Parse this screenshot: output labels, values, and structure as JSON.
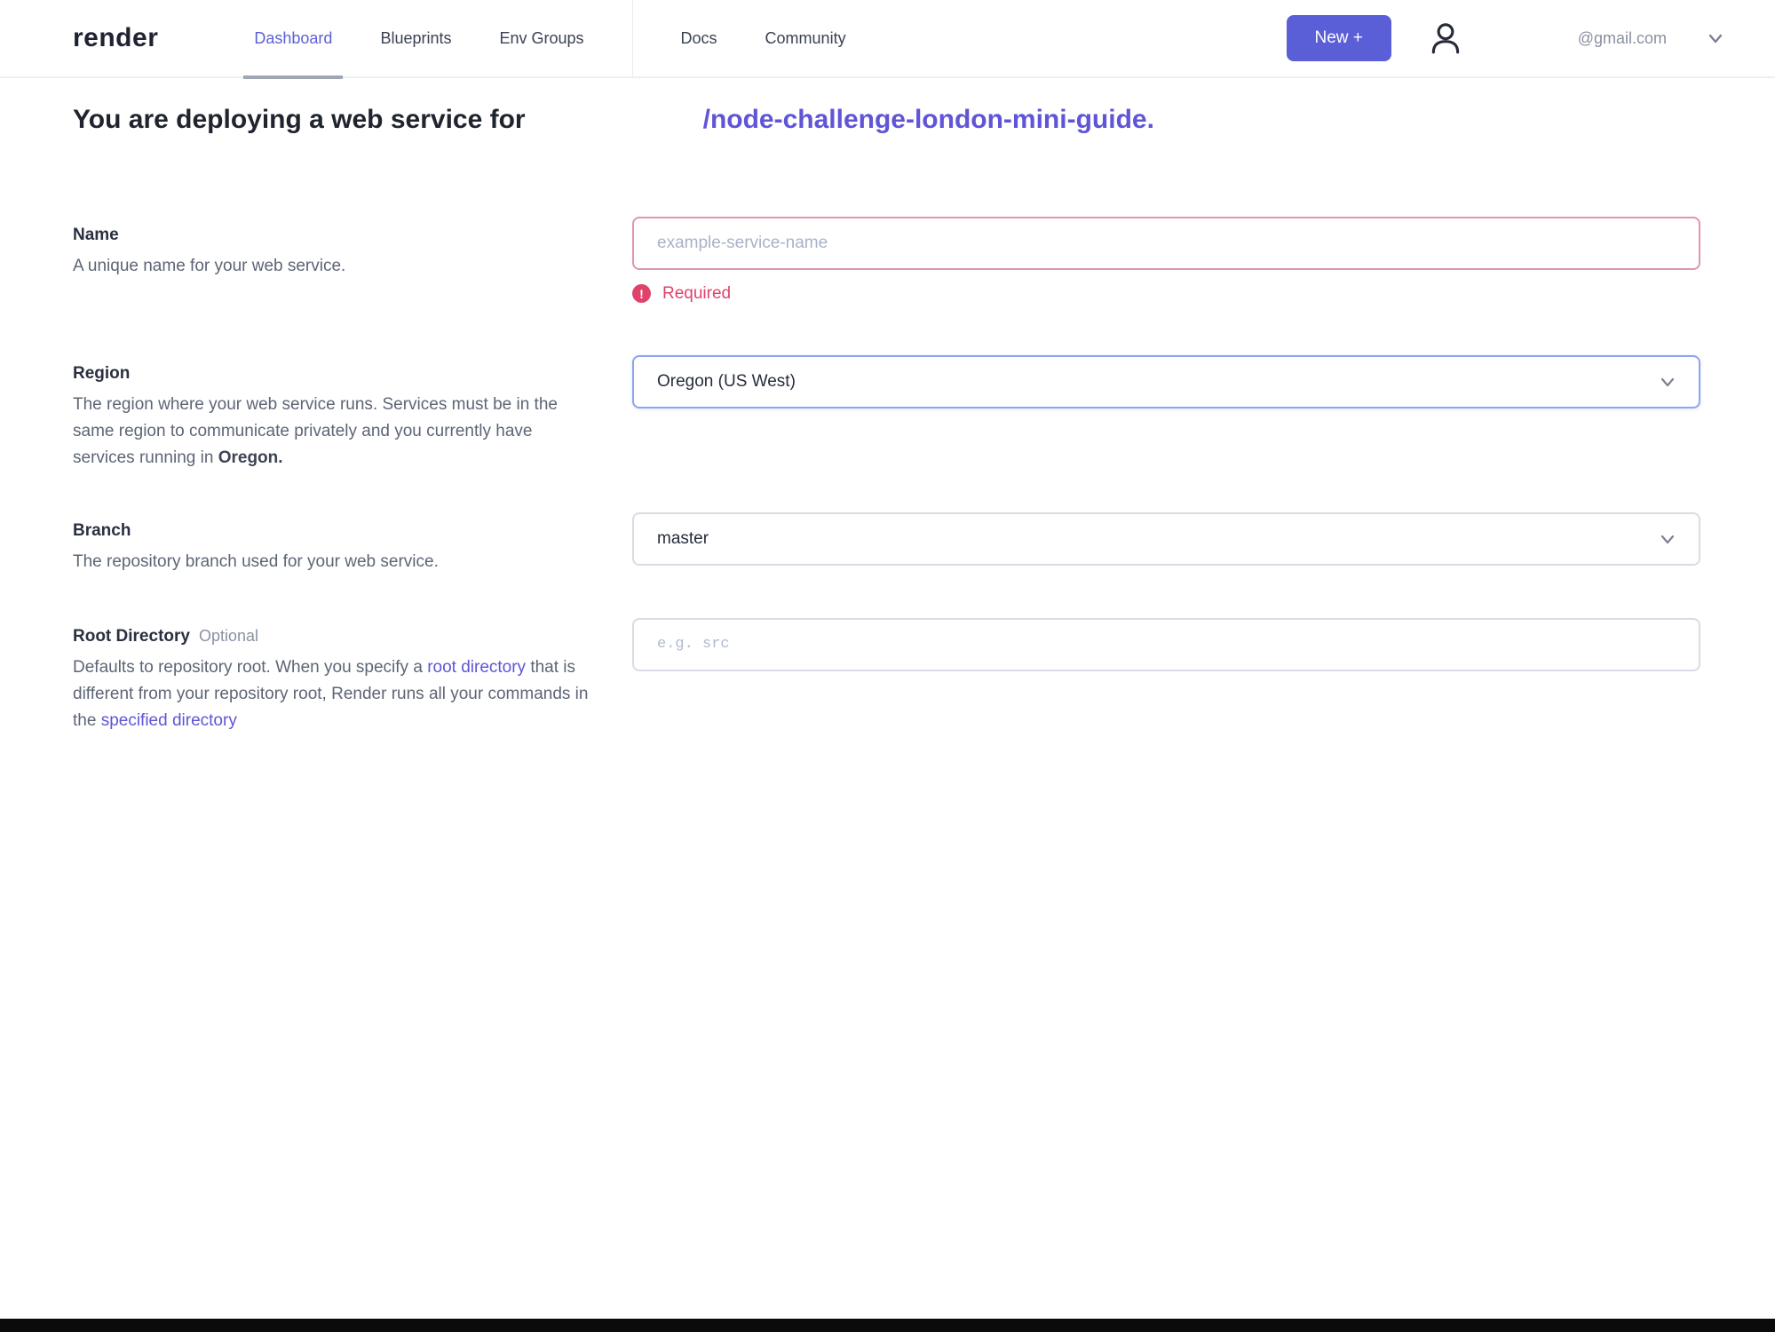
{
  "colors": {
    "accent": "#5a5fd8",
    "link_purple": "#5f55d6",
    "error_red": "#e0436a",
    "active_nav": "#5b61d8"
  },
  "header": {
    "logo": "render",
    "nav": [
      {
        "label": "Dashboard"
      },
      {
        "label": "Blueprints"
      },
      {
        "label": "Env Groups"
      },
      {
        "label": "Docs"
      },
      {
        "label": "Community"
      }
    ],
    "new_button": "New +",
    "account": {
      "email": "@gmail.com"
    }
  },
  "heading": {
    "prefix": "You are deploying a web service for",
    "repo": "/node-challenge-london-mini-guide."
  },
  "form": {
    "name": {
      "label": "Name",
      "description": "A unique name for your web service.",
      "placeholder": "example-service-name",
      "error": "Required",
      "error_icon_glyph": "!"
    },
    "region": {
      "label": "Region",
      "description": "The region where your web service runs. Services must be in the same region to communicate privately and you currently have services running in ",
      "description_emphasis": "Oregon.",
      "value": "Oregon (US West)"
    },
    "branch": {
      "label": "Branch",
      "description": "The repository branch used for your web service.",
      "value": "master"
    },
    "root_directory": {
      "label": "Root Directory",
      "optional": "Optional",
      "description_start": "Defaults to repository root. When you specify a ",
      "link_root_directory": "root directory",
      "description_middle": " that is different from your repository root, Render runs all your commands in the ",
      "link_specified_directory": "specified directory",
      "placeholder": "e.g. src"
    }
  }
}
